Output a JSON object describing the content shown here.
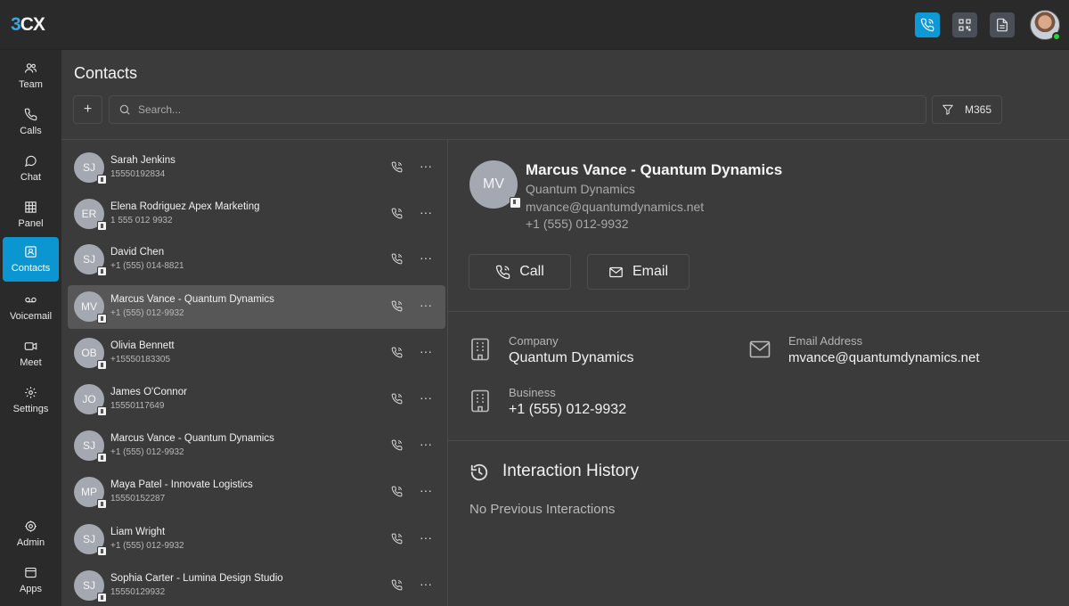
{
  "app": {
    "logo_prefix": "3",
    "logo_suffix": "CX"
  },
  "topbar": {
    "icons": [
      "phone-icon",
      "qr-code-icon",
      "document-icon"
    ],
    "status_color": "#2ecc40",
    "accent": "#0c99d6"
  },
  "sidebar": {
    "items": [
      {
        "label": "Team",
        "icon": "team-icon"
      },
      {
        "label": "Calls",
        "icon": "phone-icon"
      },
      {
        "label": "Chat",
        "icon": "chat-icon"
      },
      {
        "label": "Panel",
        "icon": "grid-icon"
      },
      {
        "label": "Contacts",
        "icon": "contact-card-icon",
        "active": true
      },
      {
        "label": "Voicemail",
        "icon": "voicemail-icon"
      },
      {
        "label": "Meet",
        "icon": "video-icon"
      },
      {
        "label": "Settings",
        "icon": "gear-icon"
      },
      {
        "label": "Admin",
        "icon": "admin-gear-icon"
      },
      {
        "label": "Apps",
        "icon": "apps-icon"
      }
    ]
  },
  "page": {
    "title": "Contacts",
    "add_label": "+",
    "search_placeholder": "Search...",
    "filter_label": "M365"
  },
  "contacts": [
    {
      "initials": "SJ",
      "name": "Sarah Jenkins",
      "phone": "15550192834"
    },
    {
      "initials": "ER",
      "name": "Elena Rodriguez Apex Marketing",
      "phone": "1 555 012 9932"
    },
    {
      "initials": "SJ",
      "name": "David Chen",
      "phone": "+1 (555) 014-8821"
    },
    {
      "initials": "MV",
      "name": "Marcus Vance - Quantum Dynamics",
      "phone": "+1 (555) 012-9932",
      "selected": true
    },
    {
      "initials": "OB",
      "name": "Olivia Bennett",
      "phone": "+15550183305"
    },
    {
      "initials": "JO",
      "name": "James O'Connor",
      "phone": "15550117649"
    },
    {
      "initials": "SJ",
      "name": "Marcus Vance - Quantum Dynamics",
      "phone": "+1 (555) 012-9932"
    },
    {
      "initials": "MP",
      "name": "Maya Patel - Innovate Logistics",
      "phone": "15550152287"
    },
    {
      "initials": "SJ",
      "name": "Liam Wright",
      "phone": "+1 (555) 012-9932"
    },
    {
      "initials": "SJ",
      "name": "Sophia Carter - Lumina Design Studio",
      "phone": "15550129932"
    }
  ],
  "detail": {
    "initials": "MV",
    "name": "Marcus Vance - Quantum Dynamics",
    "company": "Quantum Dynamics",
    "email": "mvance@quantumdynamics.net",
    "phone": "+1 (555) 012-9932",
    "call_label": "Call",
    "email_label": "Email",
    "fields": {
      "company_label": "Company",
      "company_value": "Quantum Dynamics",
      "email_label": "Email Address",
      "email_value": "mvance@quantumdynamics.net",
      "business_label": "Business",
      "business_value": "+1 (555) 012-9932"
    },
    "history_title": "Interaction History",
    "history_empty": "No Previous Interactions"
  }
}
